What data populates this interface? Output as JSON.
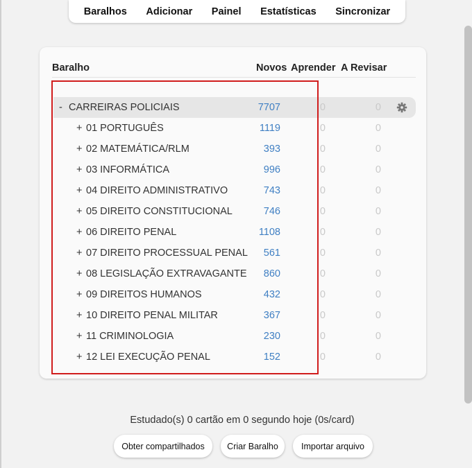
{
  "nav": {
    "items": [
      "Baralhos",
      "Adicionar",
      "Painel",
      "Estatísticas",
      "Sincronizar"
    ]
  },
  "table": {
    "headers": {
      "deck": "Baralho",
      "new": "Novos",
      "learn": "Aprender",
      "review": "A Revisar"
    },
    "root": {
      "toggle": "-",
      "name": "CARREIRAS POLICIAIS",
      "new": "7707",
      "learn": "0",
      "review": "0"
    },
    "children": [
      {
        "toggle": "+",
        "name": "01 PORTUGUÊS",
        "new": "1119",
        "learn": "0",
        "review": "0"
      },
      {
        "toggle": "+",
        "name": "02 MATEMÁTICA/RLM",
        "new": "393",
        "learn": "0",
        "review": "0"
      },
      {
        "toggle": "+",
        "name": "03 INFORMÁTICA",
        "new": "996",
        "learn": "0",
        "review": "0"
      },
      {
        "toggle": "+",
        "name": "04 DIREITO ADMINISTRATIVO",
        "new": "743",
        "learn": "0",
        "review": "0"
      },
      {
        "toggle": "+",
        "name": "05 DIREITO CONSTITUCIONAL",
        "new": "746",
        "learn": "0",
        "review": "0"
      },
      {
        "toggle": "+",
        "name": "06 DIREITO PENAL",
        "new": "1108",
        "learn": "0",
        "review": "0"
      },
      {
        "toggle": "+",
        "name": "07 DIREITO PROCESSUAL PENAL",
        "new": "561",
        "learn": "0",
        "review": "0"
      },
      {
        "toggle": "+",
        "name": "08 LEGISLAÇÃO EXTRAVAGANTE",
        "new": "860",
        "learn": "0",
        "review": "0"
      },
      {
        "toggle": "+",
        "name": "09 DIREITOS HUMANOS",
        "new": "432",
        "learn": "0",
        "review": "0"
      },
      {
        "toggle": "+",
        "name": "10 DIREITO PENAL MILITAR",
        "new": "367",
        "learn": "0",
        "review": "0"
      },
      {
        "toggle": "+",
        "name": "11 CRIMINOLOGIA",
        "new": "230",
        "learn": "0",
        "review": "0"
      },
      {
        "toggle": "+",
        "name": "12 LEI EXECUÇÃO PENAL",
        "new": "152",
        "learn": "0",
        "review": "0"
      }
    ]
  },
  "footer": {
    "studied": "Estudado(s) 0 cartão em 0 segundo hoje (0s/card)",
    "buttons": [
      "Obter compartilhados",
      "Criar Baralho",
      "Importar arquivo"
    ]
  },
  "colors": {
    "new_count": "#3f7fc3",
    "zero_count": "#c9c9c9",
    "highlight": "#d01c1c"
  },
  "icons": {
    "deck_options": "gear-icon"
  }
}
